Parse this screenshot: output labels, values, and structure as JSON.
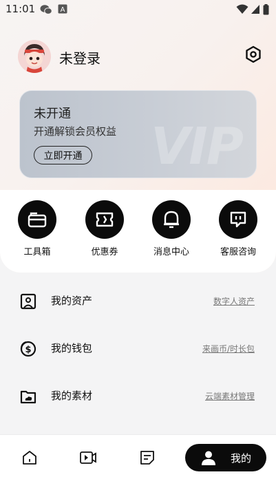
{
  "status_bar": {
    "time": "11:01",
    "icons": [
      "wechat-icon",
      "a-icon",
      "wifi-icon",
      "signal-icon",
      "battery-icon"
    ]
  },
  "profile": {
    "name": "未登录"
  },
  "vip": {
    "title": "未开通",
    "subtitle": "开通解锁会员权益",
    "button_label": "立即开通",
    "watermark": "VIP"
  },
  "quick_actions": [
    {
      "label": "工具箱",
      "icon": "toolbox-icon"
    },
    {
      "label": "优惠券",
      "icon": "coupon-icon"
    },
    {
      "label": "消息中心",
      "icon": "bell-icon"
    },
    {
      "label": "客服咨询",
      "icon": "chat-icon"
    }
  ],
  "menu": [
    {
      "label": "我的资产",
      "link": "数字人资产",
      "icon": "portrait-icon"
    },
    {
      "label": "我的钱包",
      "link": "来画币/时长包",
      "icon": "wallet-icon"
    },
    {
      "label": "我的素材",
      "link": "云端素材管理",
      "icon": "cloud-folder-icon"
    }
  ],
  "bottom_nav": {
    "items": [
      "home-icon",
      "video-icon",
      "note-icon"
    ],
    "active_label": "我的",
    "active_icon": "user-icon"
  },
  "colors": {
    "accent": "#0b0b0b",
    "background": "#f4f4f5"
  }
}
